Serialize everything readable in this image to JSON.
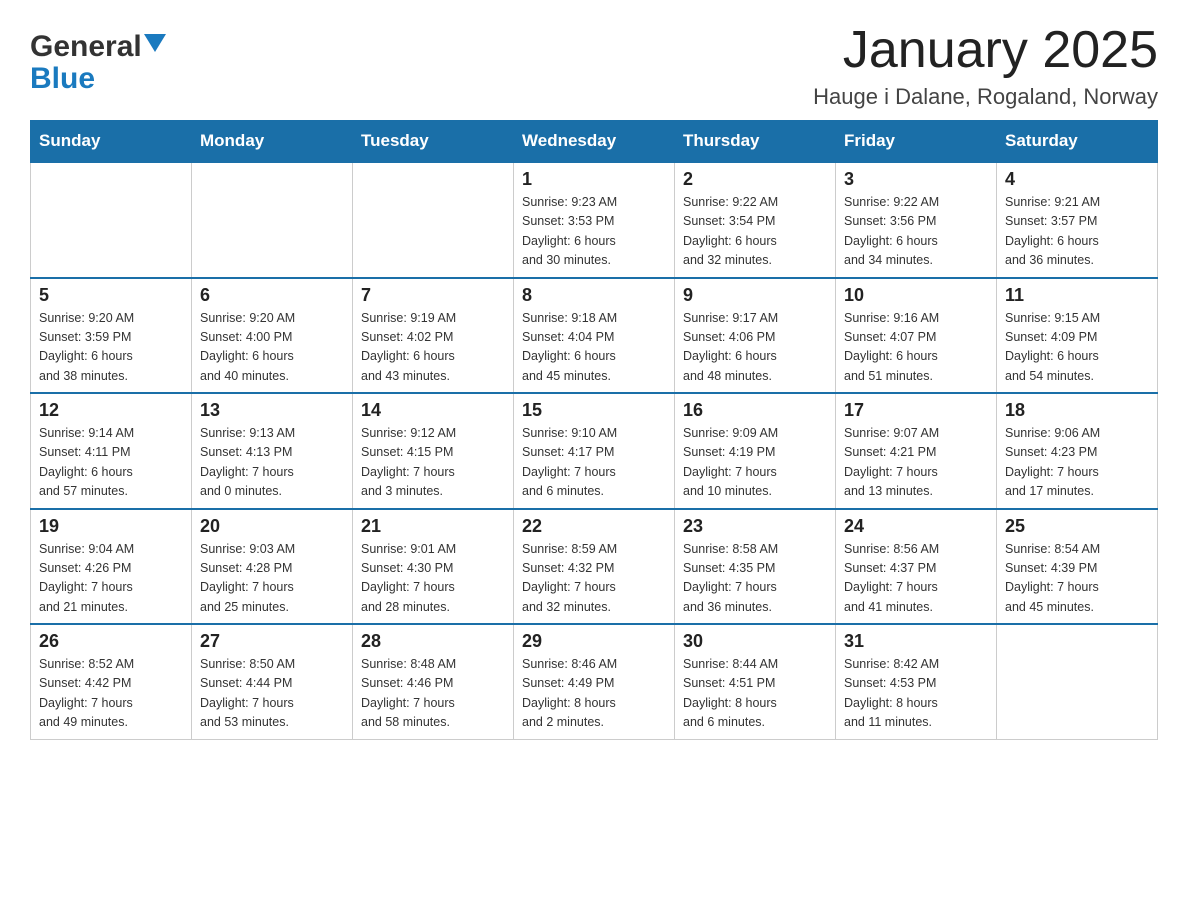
{
  "logo": {
    "general": "General",
    "blue": "Blue"
  },
  "title": "January 2025",
  "subtitle": "Hauge i Dalane, Rogaland, Norway",
  "weekdays": [
    "Sunday",
    "Monday",
    "Tuesday",
    "Wednesday",
    "Thursday",
    "Friday",
    "Saturday"
  ],
  "weeks": [
    [
      {
        "day": "",
        "info": ""
      },
      {
        "day": "",
        "info": ""
      },
      {
        "day": "",
        "info": ""
      },
      {
        "day": "1",
        "info": "Sunrise: 9:23 AM\nSunset: 3:53 PM\nDaylight: 6 hours\nand 30 minutes."
      },
      {
        "day": "2",
        "info": "Sunrise: 9:22 AM\nSunset: 3:54 PM\nDaylight: 6 hours\nand 32 minutes."
      },
      {
        "day": "3",
        "info": "Sunrise: 9:22 AM\nSunset: 3:56 PM\nDaylight: 6 hours\nand 34 minutes."
      },
      {
        "day": "4",
        "info": "Sunrise: 9:21 AM\nSunset: 3:57 PM\nDaylight: 6 hours\nand 36 minutes."
      }
    ],
    [
      {
        "day": "5",
        "info": "Sunrise: 9:20 AM\nSunset: 3:59 PM\nDaylight: 6 hours\nand 38 minutes."
      },
      {
        "day": "6",
        "info": "Sunrise: 9:20 AM\nSunset: 4:00 PM\nDaylight: 6 hours\nand 40 minutes."
      },
      {
        "day": "7",
        "info": "Sunrise: 9:19 AM\nSunset: 4:02 PM\nDaylight: 6 hours\nand 43 minutes."
      },
      {
        "day": "8",
        "info": "Sunrise: 9:18 AM\nSunset: 4:04 PM\nDaylight: 6 hours\nand 45 minutes."
      },
      {
        "day": "9",
        "info": "Sunrise: 9:17 AM\nSunset: 4:06 PM\nDaylight: 6 hours\nand 48 minutes."
      },
      {
        "day": "10",
        "info": "Sunrise: 9:16 AM\nSunset: 4:07 PM\nDaylight: 6 hours\nand 51 minutes."
      },
      {
        "day": "11",
        "info": "Sunrise: 9:15 AM\nSunset: 4:09 PM\nDaylight: 6 hours\nand 54 minutes."
      }
    ],
    [
      {
        "day": "12",
        "info": "Sunrise: 9:14 AM\nSunset: 4:11 PM\nDaylight: 6 hours\nand 57 minutes."
      },
      {
        "day": "13",
        "info": "Sunrise: 9:13 AM\nSunset: 4:13 PM\nDaylight: 7 hours\nand 0 minutes."
      },
      {
        "day": "14",
        "info": "Sunrise: 9:12 AM\nSunset: 4:15 PM\nDaylight: 7 hours\nand 3 minutes."
      },
      {
        "day": "15",
        "info": "Sunrise: 9:10 AM\nSunset: 4:17 PM\nDaylight: 7 hours\nand 6 minutes."
      },
      {
        "day": "16",
        "info": "Sunrise: 9:09 AM\nSunset: 4:19 PM\nDaylight: 7 hours\nand 10 minutes."
      },
      {
        "day": "17",
        "info": "Sunrise: 9:07 AM\nSunset: 4:21 PM\nDaylight: 7 hours\nand 13 minutes."
      },
      {
        "day": "18",
        "info": "Sunrise: 9:06 AM\nSunset: 4:23 PM\nDaylight: 7 hours\nand 17 minutes."
      }
    ],
    [
      {
        "day": "19",
        "info": "Sunrise: 9:04 AM\nSunset: 4:26 PM\nDaylight: 7 hours\nand 21 minutes."
      },
      {
        "day": "20",
        "info": "Sunrise: 9:03 AM\nSunset: 4:28 PM\nDaylight: 7 hours\nand 25 minutes."
      },
      {
        "day": "21",
        "info": "Sunrise: 9:01 AM\nSunset: 4:30 PM\nDaylight: 7 hours\nand 28 minutes."
      },
      {
        "day": "22",
        "info": "Sunrise: 8:59 AM\nSunset: 4:32 PM\nDaylight: 7 hours\nand 32 minutes."
      },
      {
        "day": "23",
        "info": "Sunrise: 8:58 AM\nSunset: 4:35 PM\nDaylight: 7 hours\nand 36 minutes."
      },
      {
        "day": "24",
        "info": "Sunrise: 8:56 AM\nSunset: 4:37 PM\nDaylight: 7 hours\nand 41 minutes."
      },
      {
        "day": "25",
        "info": "Sunrise: 8:54 AM\nSunset: 4:39 PM\nDaylight: 7 hours\nand 45 minutes."
      }
    ],
    [
      {
        "day": "26",
        "info": "Sunrise: 8:52 AM\nSunset: 4:42 PM\nDaylight: 7 hours\nand 49 minutes."
      },
      {
        "day": "27",
        "info": "Sunrise: 8:50 AM\nSunset: 4:44 PM\nDaylight: 7 hours\nand 53 minutes."
      },
      {
        "day": "28",
        "info": "Sunrise: 8:48 AM\nSunset: 4:46 PM\nDaylight: 7 hours\nand 58 minutes."
      },
      {
        "day": "29",
        "info": "Sunrise: 8:46 AM\nSunset: 4:49 PM\nDaylight: 8 hours\nand 2 minutes."
      },
      {
        "day": "30",
        "info": "Sunrise: 8:44 AM\nSunset: 4:51 PM\nDaylight: 8 hours\nand 6 minutes."
      },
      {
        "day": "31",
        "info": "Sunrise: 8:42 AM\nSunset: 4:53 PM\nDaylight: 8 hours\nand 11 minutes."
      },
      {
        "day": "",
        "info": ""
      }
    ]
  ]
}
